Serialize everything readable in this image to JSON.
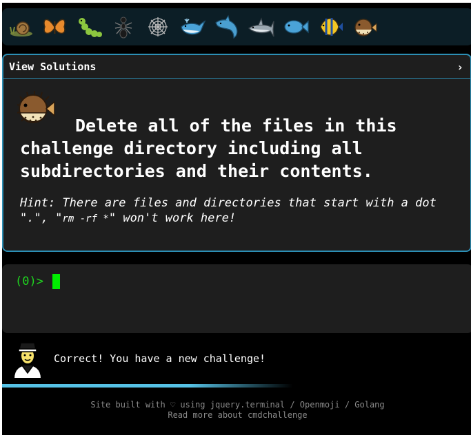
{
  "icon_bar": {
    "icons": [
      "snail-icon",
      "butterfly-icon",
      "caterpillar-icon",
      "ant-icon",
      "spider-web-icon",
      "whale-icon",
      "dolphin-icon",
      "shark-icon",
      "fish-icon",
      "tropical-fish-icon",
      "pufferfish-icon"
    ]
  },
  "solutions": {
    "title": "View Solutions",
    "toggle_icon": "›"
  },
  "challenge": {
    "text": "Delete all of the files in this challenge directory including all subdirectories and their contents.",
    "hint_prefix": "Hint: There are files and directories that start with a dot \".\", \"",
    "hint_code": "rm -rf *",
    "hint_suffix": "\" won't work here!"
  },
  "terminal": {
    "prompt": "(0)>"
  },
  "message": {
    "text": "Correct! You have a new challenge!"
  },
  "progress": {
    "fraction": 0.55
  },
  "footer": {
    "line1": "Site built with ♡ using jquery.terminal / Openmoji / Golang",
    "line2": "Read more about cmdchallenge"
  },
  "colors": {
    "accent": "#2c8fb5",
    "prompt": "#1fd41f",
    "progress": "#56c2e6"
  }
}
